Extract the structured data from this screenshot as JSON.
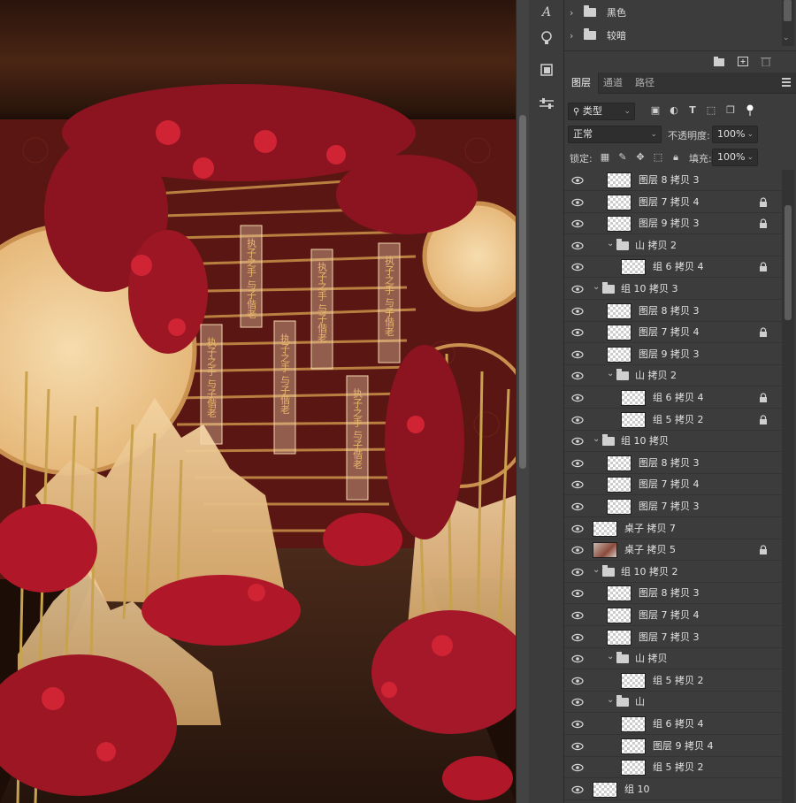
{
  "swatches": {
    "groups": [
      {
        "label": "黑色"
      },
      {
        "label": "较暗"
      }
    ]
  },
  "tabs": [
    {
      "label": "图层",
      "active": true
    },
    {
      "label": "通道",
      "active": false
    },
    {
      "label": "路径",
      "active": false
    }
  ],
  "filter": {
    "kind": "类型"
  },
  "blend": {
    "mode": "正常",
    "opacity_label": "不透明度:",
    "opacity": "100%"
  },
  "lock": {
    "label": "锁定:",
    "fill_label": "填充:",
    "fill": "100%"
  },
  "layers": [
    {
      "name": "图层 8 拷贝 3",
      "indent": 1,
      "locked": false,
      "thumb": "checker"
    },
    {
      "name": "图层 7 拷贝 4",
      "indent": 1,
      "locked": true,
      "thumb": "checker"
    },
    {
      "name": "图层 9 拷贝 3",
      "indent": 1,
      "locked": true,
      "thumb": "checker"
    },
    {
      "name": "山 拷贝 2",
      "indent": 1,
      "group": true,
      "locked": false
    },
    {
      "name": "组 6 拷贝 4",
      "indent": 2,
      "locked": true,
      "thumb": "checker"
    },
    {
      "name": "组 10 拷贝 3",
      "indent": 0,
      "group": true,
      "locked": false
    },
    {
      "name": "图层 8 拷贝 3",
      "indent": 1,
      "locked": false,
      "thumb": "checker"
    },
    {
      "name": "图层 7 拷贝 4",
      "indent": 1,
      "locked": true,
      "thumb": "checker"
    },
    {
      "name": "图层 9 拷贝 3",
      "indent": 1,
      "locked": false,
      "thumb": "checker"
    },
    {
      "name": "山 拷贝 2",
      "indent": 1,
      "group": true,
      "locked": false
    },
    {
      "name": "组 6 拷贝 4",
      "indent": 2,
      "locked": true,
      "thumb": "checker"
    },
    {
      "name": "组 5 拷贝 2",
      "indent": 2,
      "locked": true,
      "thumb": "checker"
    },
    {
      "name": "组 10 拷贝",
      "indent": 0,
      "group": true,
      "locked": false
    },
    {
      "name": "图层 8 拷贝 3",
      "indent": 1,
      "locked": false,
      "thumb": "checker"
    },
    {
      "name": "图层 7 拷贝 4",
      "indent": 1,
      "locked": false,
      "thumb": "checker"
    },
    {
      "name": "图层 7 拷贝 3",
      "indent": 1,
      "locked": false,
      "thumb": "checker"
    },
    {
      "name": "桌子 拷贝 7",
      "indent": 0,
      "locked": false,
      "thumb": "checker"
    },
    {
      "name": "桌子 拷贝 5",
      "indent": 0,
      "locked": true,
      "thumb": "img"
    },
    {
      "name": "组 10 拷贝 2",
      "indent": 0,
      "group": true,
      "locked": false
    },
    {
      "name": "图层 8 拷贝 3",
      "indent": 1,
      "locked": false,
      "thumb": "checker"
    },
    {
      "name": "图层 7 拷贝 4",
      "indent": 1,
      "locked": false,
      "thumb": "checker"
    },
    {
      "name": "图层 7 拷贝 3",
      "indent": 1,
      "locked": false,
      "thumb": "checker"
    },
    {
      "name": "山 拷贝",
      "indent": 1,
      "group": true,
      "locked": false
    },
    {
      "name": "组 5 拷贝 2",
      "indent": 2,
      "locked": false,
      "thumb": "checker"
    },
    {
      "name": "山",
      "indent": 1,
      "group": true,
      "locked": false
    },
    {
      "name": "组 6 拷贝 4",
      "indent": 2,
      "locked": false,
      "thumb": "checker"
    },
    {
      "name": "图层 9 拷贝 4",
      "indent": 2,
      "locked": false,
      "thumb": "checker"
    },
    {
      "name": "组 5 拷贝 2",
      "indent": 2,
      "locked": false,
      "thumb": "checker"
    },
    {
      "name": "组 10",
      "indent": 0,
      "locked": false,
      "thumb": "checker"
    }
  ],
  "canvas": {
    "panel_texts": [
      "执子之手 与子偕老",
      "执子之手 与子偕老",
      "执子之手 与子偕老",
      "执子之手 与子偕老",
      "执子之手 与子偕老",
      "执子之手 与子偕老",
      "执子之手 与子偕老"
    ],
    "colors": {
      "deep_red": "#8c1420",
      "bright_red": "#c8202c",
      "gold": "#d6a560",
      "wall": "#5a1612",
      "floor": "#3a2216"
    }
  }
}
